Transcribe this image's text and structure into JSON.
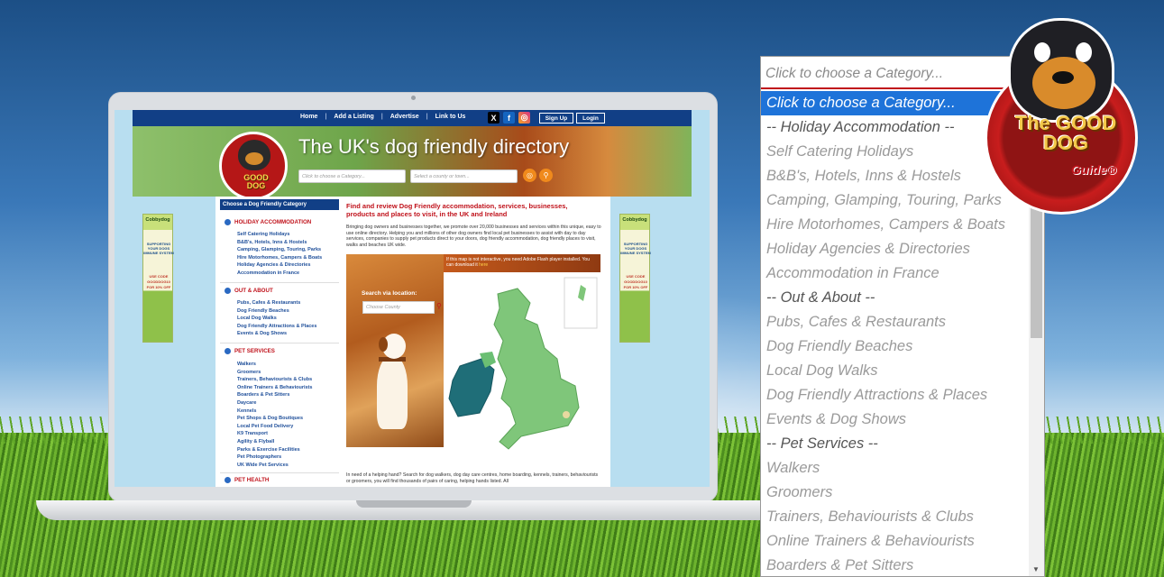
{
  "site": {
    "nav": [
      "Home",
      "Add a Listing",
      "Advertise",
      "Link to Us"
    ],
    "signup_label": "Sign Up",
    "login_label": "Login",
    "hero_title": "The UK's dog friendly directory",
    "logo_words": [
      "The",
      "GOOD",
      "DOG",
      "Guide"
    ],
    "category_placeholder": "Click to choose a Category...",
    "county_placeholder": "Select a county or town...",
    "sidebar_head": "Choose a Dog Friendly Category",
    "sections": [
      {
        "title": "HOLIDAY ACCOMMODATION",
        "items": [
          "Self Catering Holidays",
          "B&B's, Hotels, Inns & Hostels",
          "Camping, Glamping, Touring, Parks",
          "Hire Motorhomes, Campers & Boats",
          "Holiday Agencies & Directories",
          "Accommodation in France"
        ]
      },
      {
        "title": "OUT & ABOUT",
        "items": [
          "Pubs, Cafes & Restaurants",
          "Dog Friendly Beaches",
          "Local Dog Walks",
          "Dog Friendly Attractions & Places",
          "Events & Dog Shows"
        ]
      },
      {
        "title": "PET SERVICES",
        "items": [
          "Walkers",
          "Groomers",
          "Trainers, Behaviourists & Clubs",
          "Online Trainers & Behaviourists",
          "Boarders & Pet Sitters",
          "Daycare",
          "Kennels",
          "Pet Shops & Dog Boutiques",
          "Local Pet Food Delivery",
          "K9 Transport",
          "Agility & Flyball",
          "Parks & Exercise Facilities",
          "Pet Photographers",
          "UK Wide Pet Services"
        ]
      },
      {
        "title": "PET HEALTH",
        "items": []
      }
    ],
    "content_title": "Find and review Dog Friendly accommodation, services, businesses, products and places to visit, in the UK and Ireland",
    "content_intro": "Bringing dog owners and businesses together, we promote over 20,000 businesses and services within this unique, easy to use online directory. Helping you and millions of other dog owners find local pet businesses to assist with day to day services, companies to supply pet products direct to your doors, dog friendly accommodation, dog friendly places to visit, walks and beaches UK wide.",
    "search_location_label": "Search via location:",
    "county_input_placeholder": "Choose County",
    "flash_notice": "If this map is not interactive, you need Adobe Flash player installed. You can download it",
    "flash_link": "here",
    "content_outro": "In need of a helping hand? Search for dog walkers, dog day care centres, home boarding, kennels, trainers, behaviourists or groomers, you will find thousands of pairs of caring, helping hands listed. All",
    "ad": {
      "brand": "Cobbydog",
      "promo": "SUPPORTING YOUR DOGS IMMUNE SYSTEM",
      "code": "USE CODE GOODDOG10 FOR 10% OFF"
    }
  },
  "dropdown": {
    "placeholder": "Click to choose a Category...",
    "options": [
      {
        "label": "Click to choose a Category...",
        "kind": "selected"
      },
      {
        "label": "-- Holiday Accommodation --",
        "kind": "group"
      },
      {
        "label": "Self Catering Holidays",
        "kind": "item"
      },
      {
        "label": "B&B's, Hotels, Inns & Hostels",
        "kind": "item"
      },
      {
        "label": "Camping, Glamping, Touring, Parks",
        "kind": "item"
      },
      {
        "label": "Hire Motorhomes, Campers & Boats",
        "kind": "item"
      },
      {
        "label": "Holiday Agencies & Directories",
        "kind": "item"
      },
      {
        "label": "Accommodation in France",
        "kind": "item"
      },
      {
        "label": "-- Out & About --",
        "kind": "group"
      },
      {
        "label": "Pubs, Cafes & Restaurants",
        "kind": "item"
      },
      {
        "label": "Dog Friendly Beaches",
        "kind": "item"
      },
      {
        "label": "Local Dog Walks",
        "kind": "item"
      },
      {
        "label": "Dog Friendly Attractions & Places",
        "kind": "item"
      },
      {
        "label": "Events & Dog Shows",
        "kind": "item"
      },
      {
        "label": "-- Pet Services --",
        "kind": "group"
      },
      {
        "label": "Walkers",
        "kind": "item"
      },
      {
        "label": "Groomers",
        "kind": "item"
      },
      {
        "label": "Trainers, Behaviourists & Clubs",
        "kind": "item"
      },
      {
        "label": "Online Trainers & Behaviourists",
        "kind": "item"
      },
      {
        "label": "Boarders & Pet Sitters",
        "kind": "item"
      }
    ]
  },
  "big_logo": {
    "words": "The GOOD DOG",
    "guide": "Guide®"
  },
  "colors": {
    "nav_blue": "#113f86",
    "accent_red": "#c0121b",
    "select_blue": "#1e73d9"
  }
}
